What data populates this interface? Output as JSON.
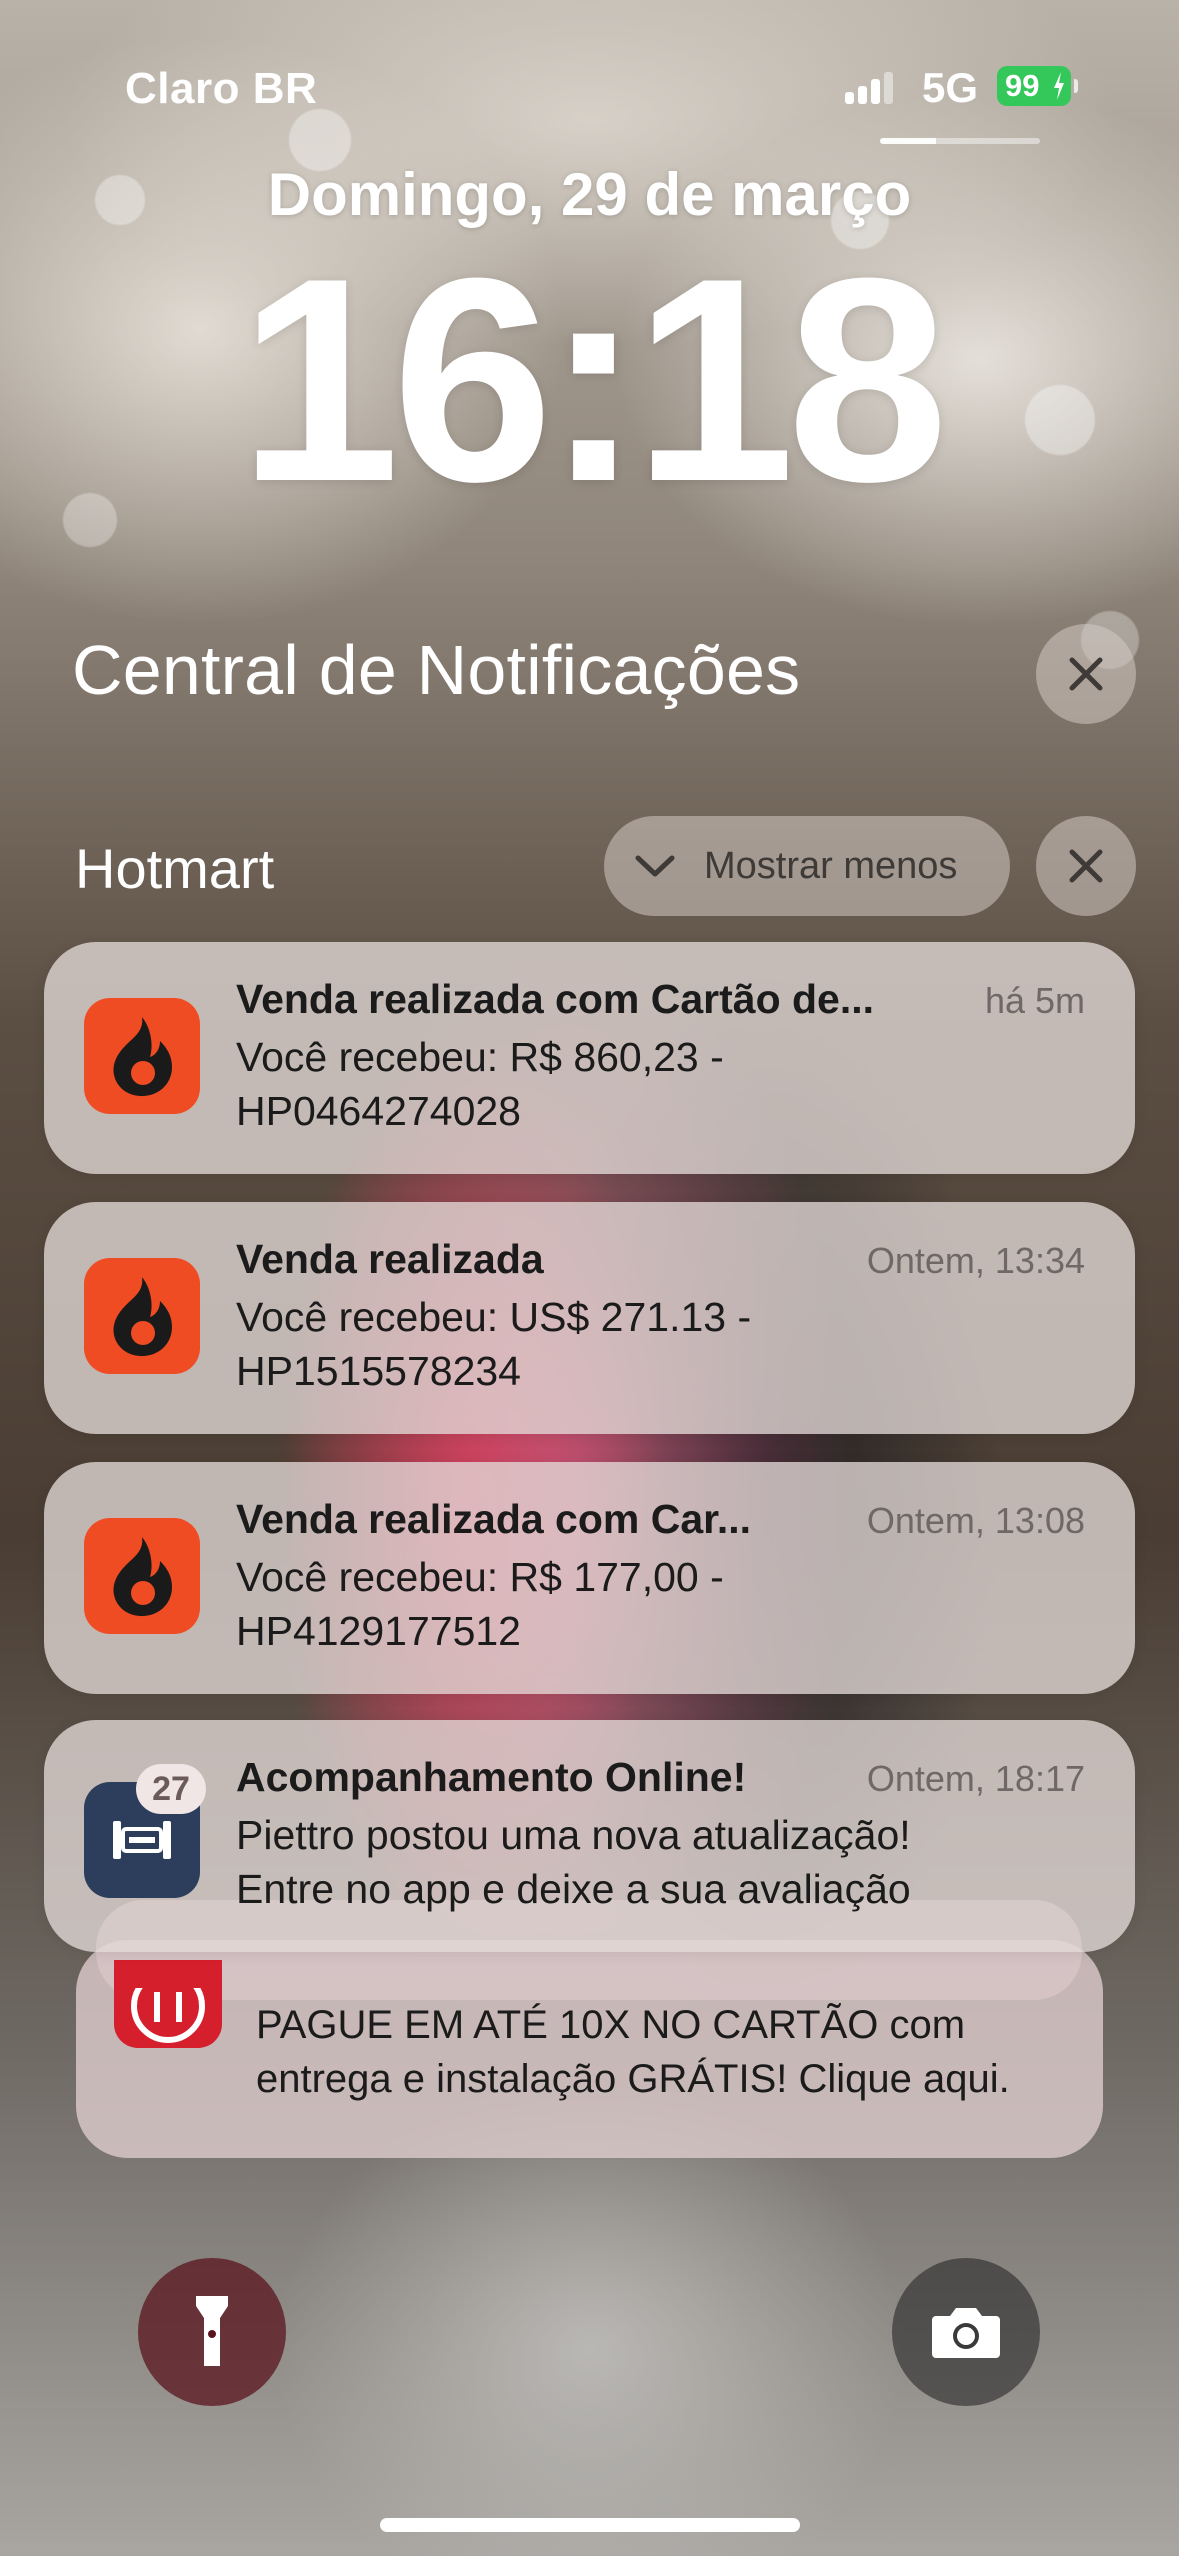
{
  "status_bar": {
    "carrier": "Claro BR",
    "network": "5G",
    "battery": "99"
  },
  "lock_screen": {
    "date": "Domingo, 29 de março",
    "time": "16:18"
  },
  "notification_center": {
    "title": "Central de Notificações",
    "group": {
      "name": "Hotmart",
      "show_less_label": "Mostrar menos"
    },
    "notifications": [
      {
        "app_icon": "hotmart-flame-icon",
        "title": "Venda realizada com Cartão de...",
        "time": "há 5m",
        "body_line1": "Você recebeu: R$ 860,23 -",
        "body_line2": "HP0464274028"
      },
      {
        "app_icon": "hotmart-flame-icon",
        "title": "Venda realizada",
        "time": "Ontem, 13:34",
        "body_line1": "Você recebeu: US$ 271.13 -",
        "body_line2": "HP1515578234"
      },
      {
        "app_icon": "hotmart-flame-icon",
        "title": "Venda realizada com Car...",
        "time": "Ontem, 13:08",
        "body_line1": "Você recebeu: R$ 177,00 -",
        "body_line2": "HP4129177512"
      },
      {
        "app_icon": "fitness-app-icon",
        "badge": "27",
        "title": "Acompanhamento Online!",
        "time": "Ontem, 18:17",
        "body_line1": "Piettro postou uma nova atualização!",
        "body_line2": "Entre no app e deixe a sua avaliação"
      }
    ],
    "stacked_notification": {
      "app_icon": "store-app-icon",
      "body_line1": "PAGUE EM ATÉ 10X NO CARTÃO com",
      "body_line2": "entrega e instalação GRÁTIS! Clique aqui."
    }
  },
  "bottom_controls": {
    "left": "flashlight-icon",
    "right": "camera-icon"
  },
  "colors": {
    "hotmart_orange": "#ef4c23",
    "battery_green": "#34c759",
    "fitness_navy": "#2c3e5c",
    "store_red": "#d61f2c"
  }
}
